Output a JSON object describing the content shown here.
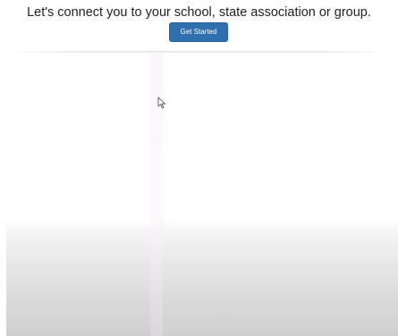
{
  "header": {
    "headline": "Let's connect you to your school, state association or group.",
    "button_label": "Get Started"
  },
  "colors": {
    "button_bg": "#2f6fae",
    "button_text": "#ffffff",
    "headline_text": "#1f1f1f"
  },
  "icons": {
    "cursor": "mouse-pointer-icon"
  }
}
